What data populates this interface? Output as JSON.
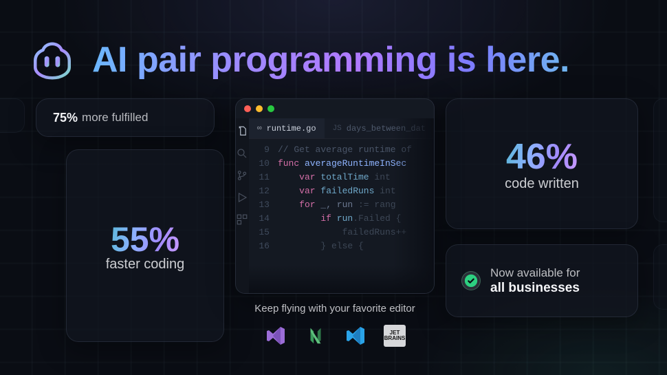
{
  "hero": {
    "title": "AI pair programming is here."
  },
  "fulfilled": {
    "value": "75%",
    "label": "more fulfilled"
  },
  "faster": {
    "value": "55%",
    "label": "faster coding"
  },
  "code_written": {
    "value": "46%",
    "label": "code written"
  },
  "availability": {
    "line1": "Now available for",
    "line2": "all businesses"
  },
  "editor": {
    "tabs": [
      {
        "icon": "∞",
        "name": "runtime.go",
        "active": true
      },
      {
        "icon": "JS",
        "name": "days_between_dat",
        "active": false
      }
    ],
    "code": [
      {
        "n": "9",
        "seg": [
          {
            "c": "cm-comment",
            "t": "// Get average runtime of"
          }
        ]
      },
      {
        "n": "10",
        "seg": [
          {
            "c": "cm-keyword",
            "t": "func "
          },
          {
            "c": "cm-func",
            "t": "averageRuntimeInSec"
          }
        ]
      },
      {
        "n": "11",
        "seg": [
          {
            "c": "cm-plain",
            "t": "    "
          },
          {
            "c": "cm-keyword",
            "t": "var "
          },
          {
            "c": "cm-var",
            "t": "totalTime "
          },
          {
            "c": "cm-ghost",
            "t": "int"
          }
        ]
      },
      {
        "n": "12",
        "seg": [
          {
            "c": "cm-plain",
            "t": "    "
          },
          {
            "c": "cm-keyword",
            "t": "var "
          },
          {
            "c": "cm-var",
            "t": "failedRuns "
          },
          {
            "c": "cm-ghost",
            "t": "int"
          }
        ]
      },
      {
        "n": "13",
        "seg": [
          {
            "c": "cm-plain",
            "t": "    "
          },
          {
            "c": "cm-keyword",
            "t": "for "
          },
          {
            "c": "cm-plain",
            "t": "_, run "
          },
          {
            "c": "cm-ghost",
            "t": ":= rang"
          }
        ]
      },
      {
        "n": "14",
        "seg": [
          {
            "c": "cm-plain",
            "t": "        "
          },
          {
            "c": "cm-keyword",
            "t": "if "
          },
          {
            "c": "cm-var",
            "t": "run"
          },
          {
            "c": "cm-ghost",
            "t": ".Failed {"
          }
        ]
      },
      {
        "n": "15",
        "seg": [
          {
            "c": "cm-plain",
            "t": "            "
          },
          {
            "c": "cm-ghost",
            "t": "failedRuns++"
          }
        ]
      },
      {
        "n": "16",
        "seg": [
          {
            "c": "cm-plain",
            "t": "        "
          },
          {
            "c": "cm-ghost",
            "t": "} else {"
          }
        ]
      }
    ]
  },
  "below": {
    "caption": "Keep flying with your favorite editor"
  },
  "editor_brands": [
    "visual-studio",
    "neovim",
    "vscode",
    "jetbrains"
  ]
}
